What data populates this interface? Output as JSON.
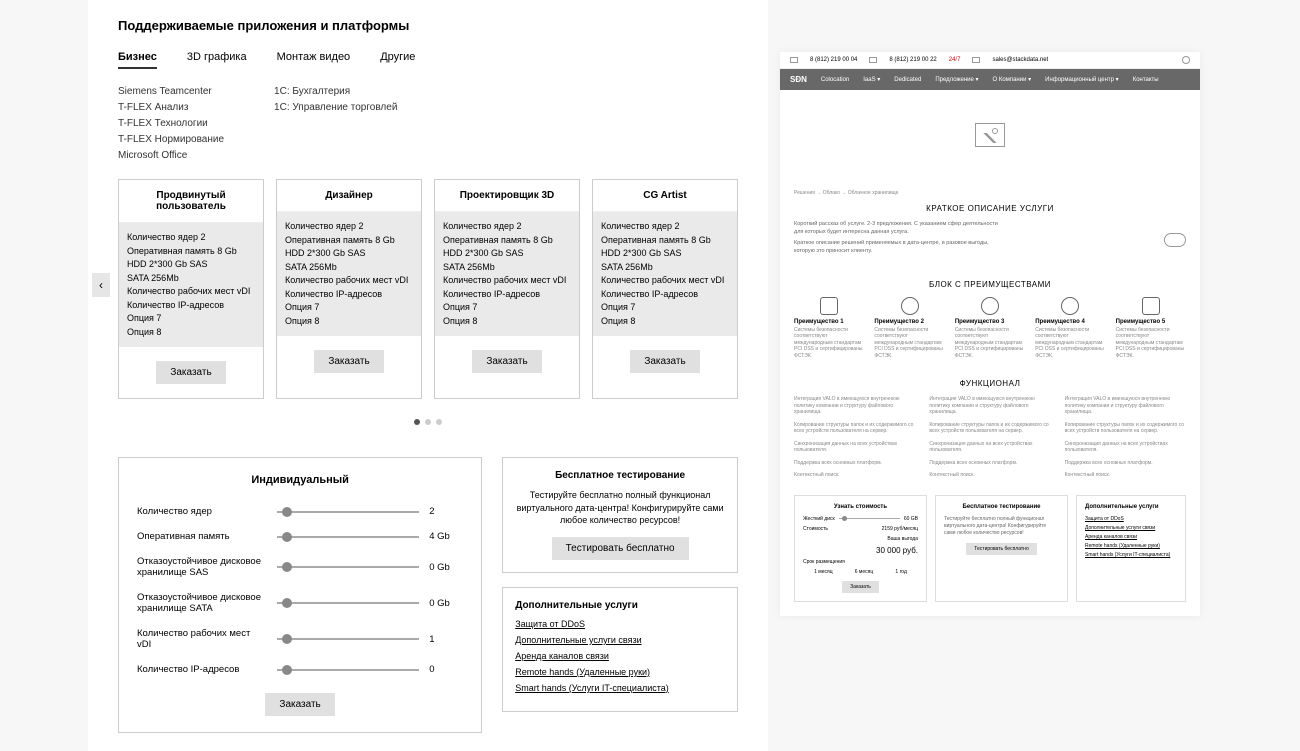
{
  "heading": "Поддерживаемые приложения и платформы",
  "tabs": [
    "Бизнес",
    "3D графика",
    "Монтаж видео",
    "Другие"
  ],
  "apps_col1": [
    "Siemens Teamcenter",
    "T-FLEX Анализ",
    "T-FLEX Технологии",
    "T-FLEX Нормирование",
    "Microsoft Office"
  ],
  "apps_col2": [
    "1С: Бухгалтерия",
    "1С: Управление торговлей"
  ],
  "cards": [
    {
      "title": "Продвинутый пользователь",
      "specs": [
        "Количество ядер 2",
        "Оперативная память 8 Gb",
        "HDD 2*300 Gb SAS",
        "SATA 256Mb",
        "Количество рабочих мест vDI",
        "Количество IP-адресов",
        "Опция 7",
        "Опция 8"
      ],
      "btn": "Заказать"
    },
    {
      "title": "Дизайнер",
      "specs": [
        "Количество ядер 2",
        "Оперативная память 8 Gb",
        "HDD 2*300 Gb SAS",
        "SATA 256Mb",
        "Количество рабочих мест vDI",
        "Количество IP-адресов",
        "Опция 7",
        "Опция 8"
      ],
      "btn": "Заказать"
    },
    {
      "title": "Проектировщик 3D",
      "specs": [
        "Количество ядер 2",
        "Оперативная память 8 Gb",
        "HDD 2*300 Gb SAS",
        "SATA 256Mb",
        "Количество рабочих мест vDI",
        "Количество IP-адресов",
        "Опция 7",
        "Опция 8"
      ],
      "btn": "Заказать"
    },
    {
      "title": "CG Artist",
      "specs": [
        "Количество ядер 2",
        "Оперативная память 8 Gb",
        "HDD 2*300 Gb SAS",
        "SATA 256Mb",
        "Количество рабочих мест vDI",
        "Количество IP-адресов",
        "Опция 7",
        "Опция 8"
      ],
      "btn": "Заказать"
    }
  ],
  "config": {
    "title": "Индивидуальный",
    "rows": [
      {
        "label": "Количество ядер",
        "val": "2"
      },
      {
        "label": "Оперативная память",
        "val": "4 Gb"
      },
      {
        "label": "Отказоустойчивое дисковое хранилище SAS",
        "val": "0 Gb"
      },
      {
        "label": "Отказоустойчивое дисковое хранилище SATA",
        "val": "0 Gb"
      },
      {
        "label": "Количество рабочих мест vDI",
        "val": "1"
      },
      {
        "label": "Количество IP-адресов",
        "val": "0"
      }
    ],
    "btn": "Заказать"
  },
  "trial": {
    "title": "Бесплатное тестирование",
    "text": "Тестируйте бесплатно полный функционал виртуального дата-центра! Конфигурируйте сами любое количество ресурсов!",
    "btn": "Тестировать бесплатно"
  },
  "extras": {
    "title": "Дополнительные услуги",
    "links": [
      "Защита от DDoS",
      "Дополнительные услуги связи",
      "Аренда каналов связи",
      "Remote hands (Удаленные руки)",
      "Smart hands (Услуги IT-специалиста)"
    ]
  },
  "mock": {
    "phone1": "8 (812) 219 00 04",
    "phone2": "8 (812) 219 00 22",
    "tag": "24/7",
    "email": "sales@stackdata.net",
    "logo": "SĐN",
    "nav": [
      "Colocation",
      "IaaS ▾",
      "Dedicated",
      "Предложение ▾",
      "О Компании ▾",
      "Информационный центр ▾",
      "Контакты"
    ],
    "crumb": "Решения → Облако → Облачное хранилище",
    "h1": "КРАТКОЕ ОПИСАНИЕ УСЛУГИ",
    "d1": "Короткий рассказ об услуге. 2-3 предложения. С указанием сфер деятельности для которых будет интересна данная услуга.",
    "d2": "Краткое описание решений применяемых в дата-центре, и разовое выгоды, которую это приносит клиенту.",
    "h2": "БЛОК С ПРЕИМУЩЕСТВАМИ",
    "adv": [
      {
        "t": "Преимущество 1",
        "d": "Системы безопасности соответствуют международным стандартам PCI DSS и сертифицированы ФСТЭК."
      },
      {
        "t": "Преимущество 2",
        "d": "Системы безопасности соответствуют международным стандартам PCI DSS и сертифицированы ФСТЭК."
      },
      {
        "t": "Преимущество 3",
        "d": "Системы безопасности соответствуют международным стандартам PCI DSS и сертифицированы ФСТЭК."
      },
      {
        "t": "Преимущество 4",
        "d": "Системы безопасности соответствуют международным стандартам PCI DSS и сертифицированы ФСТЭК."
      },
      {
        "t": "Преимущество 5",
        "d": "Системы безопасности соответствуют международным стандартам PCI DSS и сертифицированы ФСТЭК."
      }
    ],
    "h3": "ФУНКЦИОНАЛ",
    "func": [
      "Интеграция VALO в имеющуюся внутреннюю политику компании и структуру файлового хранилища.",
      "Копирование структуры папок и их содержимого со всех устройств пользователя на сервер.",
      "Синхронизация данных на всех устройствах пользователя.",
      "Поддержка всех основных платформ.",
      "Контекстный поиск."
    ],
    "cost": {
      "title": "Узнать стоимость",
      "r1l": "Жесткий диск",
      "r1v": "60 GB",
      "r2l": "Стоимость",
      "r2v": "2159 руб/месяц",
      "big_l": "Ваша выгода",
      "big": "30 000 руб.",
      "r3l": "Срок размещения",
      "o1": "1 месяц",
      "o2": "6 месяц",
      "o3": "1 год",
      "btn": "Заказать"
    },
    "trial": {
      "title": "Бесплатное тестирование",
      "text": "Тестируйте бесплатно полный функционал виртуального дата-центра! Конфигурируйте сами любое количество ресурсов!",
      "btn": "Тестировать бесплатно"
    },
    "ext": {
      "title": "Дополнительные услуги",
      "links": [
        "Защита от DDoS",
        "Дополнительные услуги связи",
        "Аренда каналов связи",
        "Remote hands (Удаленные руки)",
        "Smart hands (Услуги IT-специалиста)"
      ]
    }
  }
}
